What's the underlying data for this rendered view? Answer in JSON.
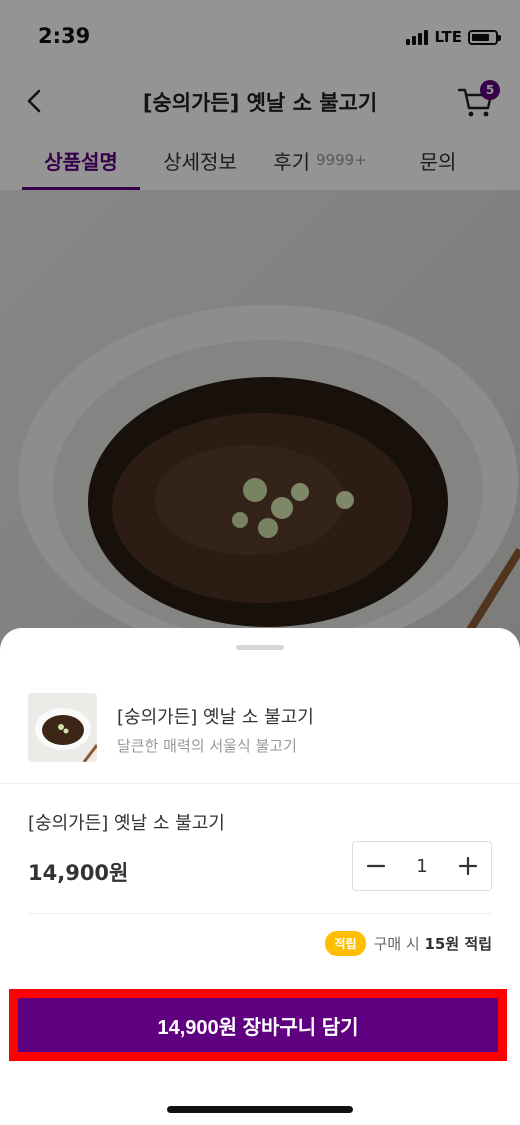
{
  "status_bar": {
    "time": "2:39",
    "network": "LTE"
  },
  "header": {
    "title": "[숭의가든] 옛날 소 불고기",
    "cart_count": "5"
  },
  "tabs": [
    {
      "label": "상품설명",
      "active": true
    },
    {
      "label": "상세정보",
      "active": false
    },
    {
      "label": "후기",
      "count": "9999+",
      "active": false
    },
    {
      "label": "문의",
      "active": false
    }
  ],
  "sheet": {
    "product_name": "[숭의가든] 옛날 소 불고기",
    "product_description": "달큰한 매력의 서울식 불고기",
    "option_name": "[숭의가든] 옛날 소 불고기",
    "option_price": "14,900원",
    "quantity": "1",
    "points_badge": "적립",
    "points_prefix": "구매 시 ",
    "points_amount": "15원 적립",
    "cta_label": "14,900원 장바구니 담기"
  },
  "colors": {
    "accent": "#5f0080",
    "points": "#ffbf00",
    "highlight": "#ff0000"
  }
}
